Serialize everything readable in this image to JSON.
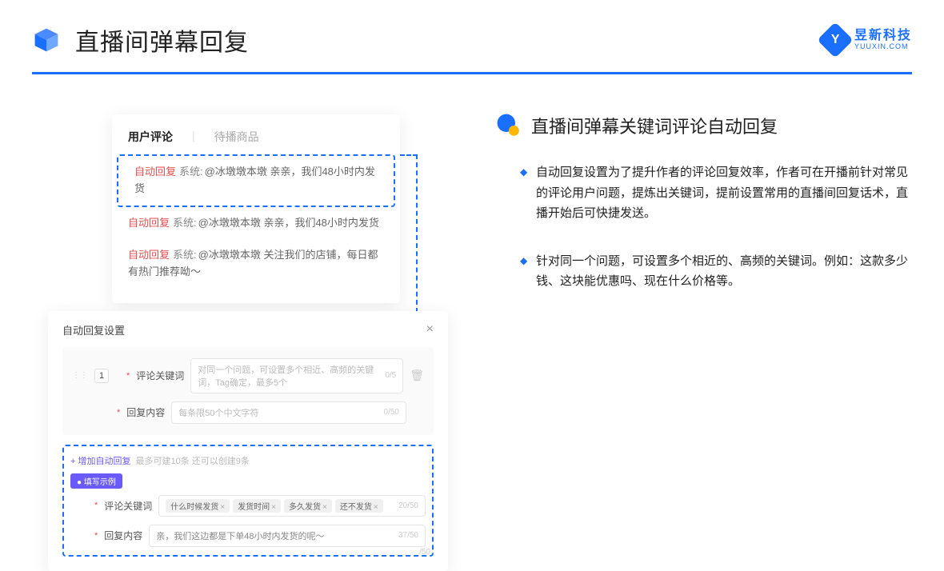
{
  "header": {
    "title": "直播间弹幕回复",
    "brand_name": "昱新科技",
    "brand_sub": "YUUXIN.COM",
    "brand_letter": "Y"
  },
  "tabs": {
    "active": "用户评论",
    "inactive": "待播商品"
  },
  "comments": {
    "auto_tag": "自动回复",
    "sys_tag": "系统:",
    "row1": "@冰墩墩本墩 亲亲，我们48小时内发货",
    "row2": "@冰墩墩本墩 亲亲，我们48小时内发货",
    "row3": "@冰墩墩本墩 关注我们的店铺，每日都有热门推荐呦～"
  },
  "settings": {
    "title": "自动回复设置",
    "close": "×",
    "idx": "1",
    "kw_label": "评论关键词",
    "kw_placeholder": "对同一个问题，可设置多个相近、高频的关键词，Tag确定，最多5个",
    "kw_count": "0/5",
    "content_label": "回复内容",
    "content_placeholder": "每条限50个中文字符",
    "content_count": "0/50",
    "add_text": "+ 增加自动回复",
    "add_hint": "最多可建10条 还可以创建9条",
    "example_tag": "● 填写示例",
    "ex_kw_label": "评论关键词",
    "chips": [
      "什么时候发货",
      "发货时间",
      "多久发货",
      "还不发货"
    ],
    "chip_count": "20/50",
    "ex_content_label": "回复内容",
    "ex_content_value": "亲，我们这边都是下单48小时内发货的呢～",
    "ex_content_count": "37/50",
    "bottom_count": "/50"
  },
  "right": {
    "section_title": "直播间弹幕关键词评论自动回复",
    "bullet1": "自动回复设置为了提升作者的评论回复效率，作者可在开播前针对常见的评论用户问题，提炼出关键词，提前设置常用的直播间回复话术，直播开始后可快捷发送。",
    "bullet2": "针对同一个问题，可设置多个相近的、高频的关键词。例如：这款多少钱、这块能优惠吗、现在什么价格等。"
  }
}
